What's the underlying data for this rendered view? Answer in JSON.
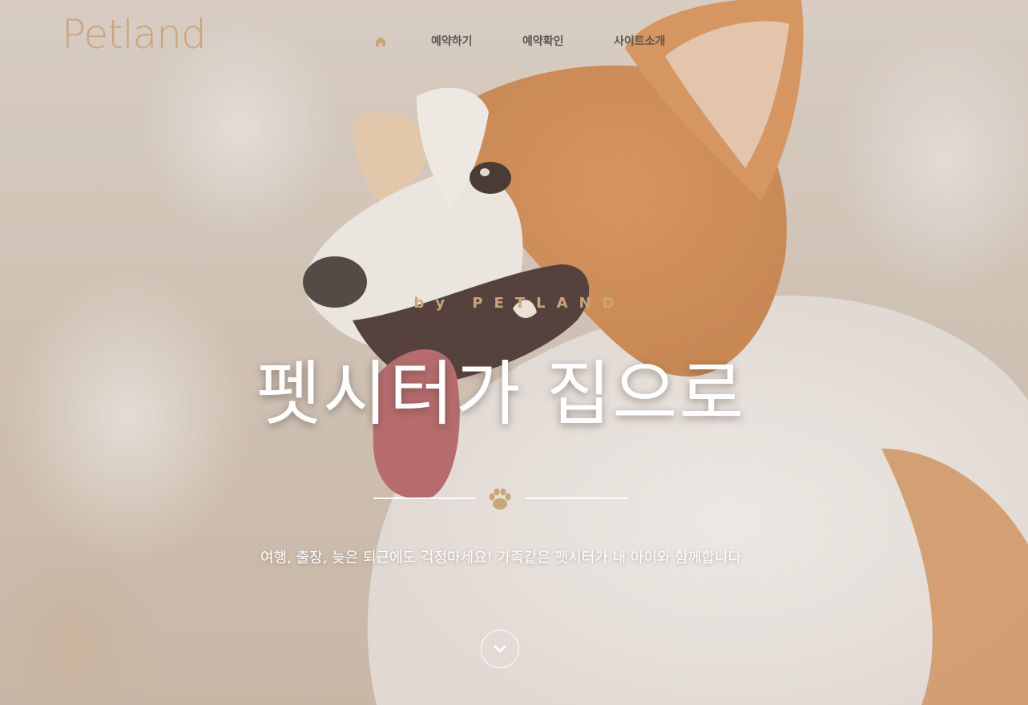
{
  "brand": {
    "name": "Petland"
  },
  "nav": {
    "home_icon": "home-icon",
    "items": [
      {
        "label": "예약하기"
      },
      {
        "label": "예약확인"
      },
      {
        "label": "사이트소개"
      }
    ]
  },
  "hero": {
    "eyebrow": "by PETLAND",
    "headline": "펫시터가 집으로",
    "divider_icon": "paw-icon",
    "subtitle": "여행, 출장, 늦은 퇴근에도 걱정마세요! 가족같은 펫시터가 내 아이와 함께합니다",
    "scroll_icon": "chevron-down-icon"
  },
  "colors": {
    "accent": "#c9a57a",
    "nav_text": "#5d5750",
    "hero_text": "#ffffff"
  }
}
